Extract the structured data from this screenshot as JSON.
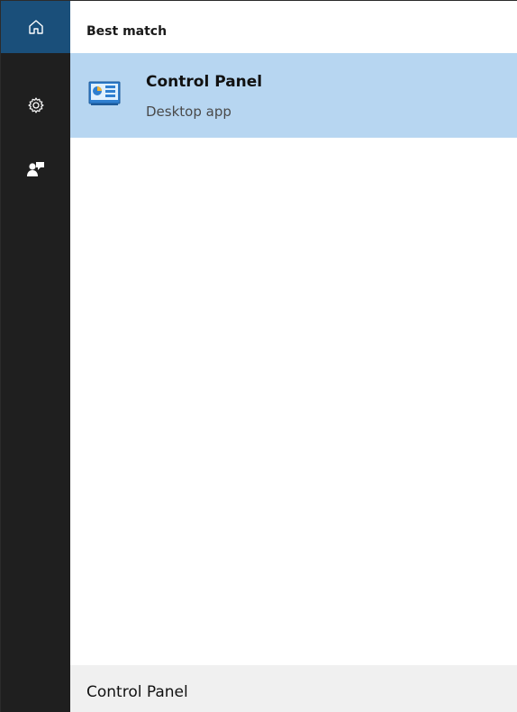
{
  "rail": {
    "items": [
      {
        "icon": "home-icon",
        "active": true
      },
      {
        "icon": "gear-icon",
        "active": false
      },
      {
        "icon": "feedback-icon",
        "active": false
      }
    ]
  },
  "results": {
    "section_heading": "Best match",
    "best_match": {
      "title": "Control Panel",
      "subtitle": "Desktop app",
      "icon": "control-panel-icon"
    }
  },
  "search": {
    "query": "Control Panel"
  },
  "colors": {
    "rail_background": "#1f1f1f",
    "rail_active": "#1a4f7a",
    "selection": "#b7d6f1",
    "search_bar": "#f0f0f0"
  }
}
